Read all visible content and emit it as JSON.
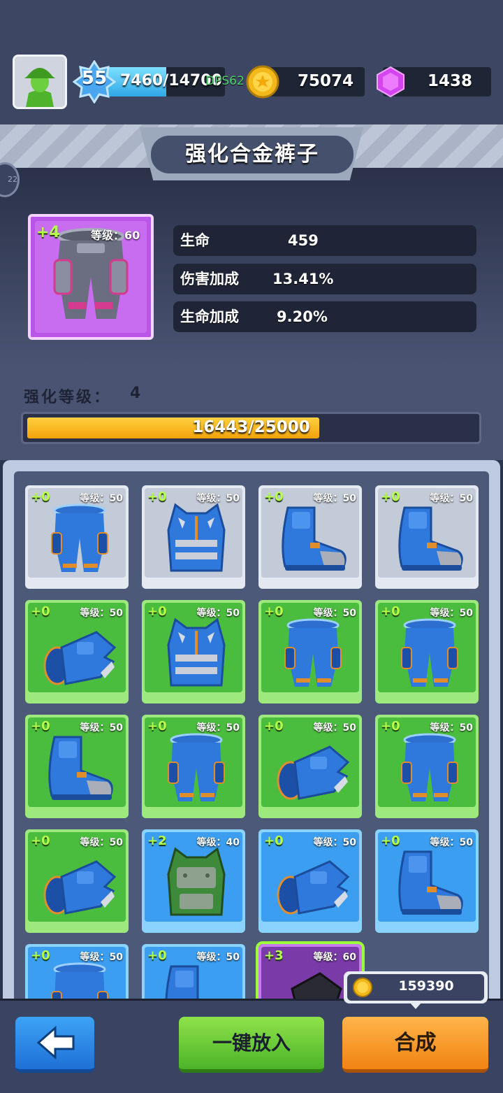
{
  "player": {
    "level": "55",
    "xp": "7460/14700",
    "xp_fraction": 0.51,
    "dps_label": "DPS62",
    "coins": "75074",
    "gems": "1438"
  },
  "screen_title": "强化合金裤子",
  "side_badge": "22",
  "selected_item": {
    "plus": "+4",
    "level_label": "等级：60",
    "rarity_color": "#bb55e8",
    "stats": [
      {
        "label": "生命",
        "value": "459"
      },
      {
        "label": "伤害加成",
        "value": "13.41%"
      },
      {
        "label": "生命加成",
        "value": "9.20%"
      }
    ]
  },
  "enhance": {
    "label": "强化等级：",
    "level": "4",
    "progress_text": "16443/25000",
    "progress_fraction": 0.658
  },
  "items": [
    {
      "plus": "+0",
      "lv": "等级：50",
      "rarity": "grey",
      "icon": "pants-icon"
    },
    {
      "plus": "+0",
      "lv": "等级：50",
      "rarity": "grey",
      "icon": "armor-vest-icon"
    },
    {
      "plus": "+0",
      "lv": "等级：50",
      "rarity": "grey",
      "icon": "boot-icon"
    },
    {
      "plus": "+0",
      "lv": "等级：50",
      "rarity": "grey",
      "icon": "boot-icon"
    },
    {
      "plus": "+0",
      "lv": "等级：50",
      "rarity": "green",
      "icon": "glove-icon"
    },
    {
      "plus": "+0",
      "lv": "等级：50",
      "rarity": "green",
      "icon": "armor-vest-icon"
    },
    {
      "plus": "+0",
      "lv": "等级：50",
      "rarity": "green",
      "icon": "pants-icon"
    },
    {
      "plus": "+0",
      "lv": "等级：50",
      "rarity": "green",
      "icon": "pants-icon"
    },
    {
      "plus": "+0",
      "lv": "等级：50",
      "rarity": "green",
      "icon": "boot-icon"
    },
    {
      "plus": "+0",
      "lv": "等级：50",
      "rarity": "green",
      "icon": "pants-icon"
    },
    {
      "plus": "+0",
      "lv": "等级：50",
      "rarity": "green",
      "icon": "glove-icon"
    },
    {
      "plus": "+0",
      "lv": "等级：50",
      "rarity": "green",
      "icon": "pants-icon"
    },
    {
      "plus": "+0",
      "lv": "等级：50",
      "rarity": "green",
      "icon": "glove-icon"
    },
    {
      "plus": "+2",
      "lv": "等级：40",
      "rarity": "blue",
      "icon": "green-armor-vest-icon"
    },
    {
      "plus": "+0",
      "lv": "等级：50",
      "rarity": "blue",
      "icon": "glove-icon"
    },
    {
      "plus": "+0",
      "lv": "等级：50",
      "rarity": "blue",
      "icon": "boot-icon"
    },
    {
      "plus": "+0",
      "lv": "等级：50",
      "rarity": "blue",
      "icon": "pants-icon"
    },
    {
      "plus": "+0",
      "lv": "等级：50",
      "rarity": "blue",
      "icon": "boot-icon"
    },
    {
      "plus": "+3",
      "lv": "等级：60",
      "rarity": "purple",
      "icon": "dark-glove-icon",
      "selected": true
    }
  ],
  "merge_cost": "159390",
  "buttons": {
    "put_in": "一键放入",
    "merge": "合成"
  },
  "colors": {
    "grey": "#c4cbd8",
    "green": "#4bbd3e",
    "blue": "#3b9ef0",
    "purple": "#7a3aa8"
  }
}
